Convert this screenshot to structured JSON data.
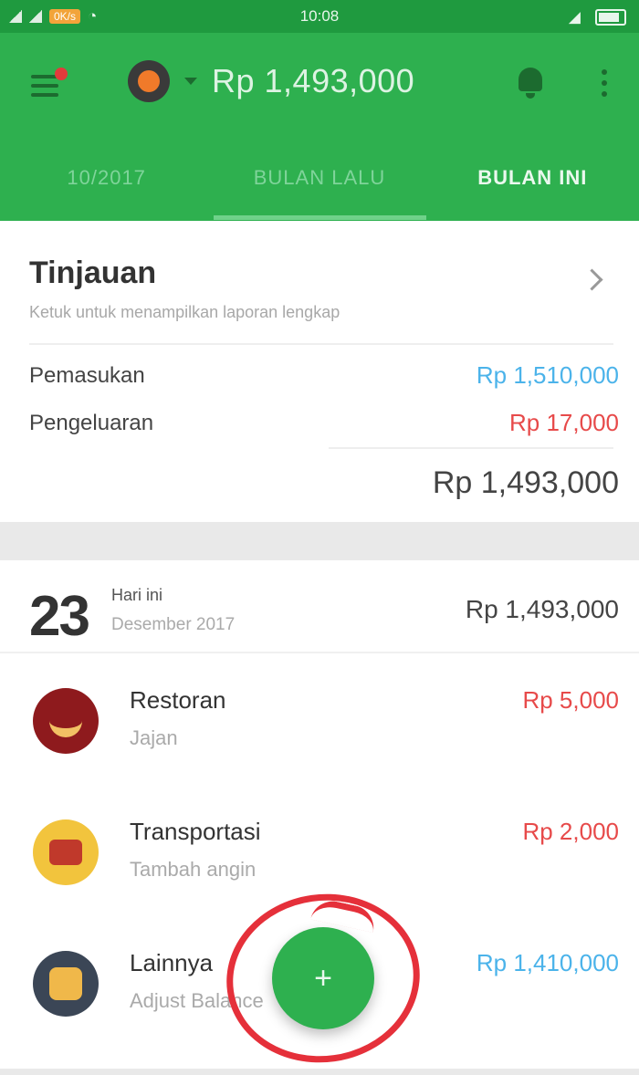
{
  "status_bar": {
    "time": "10:08",
    "speed_badge": "0K/s"
  },
  "appbar": {
    "balance": "Rp 1,493,000",
    "tabs": [
      {
        "label": "10/2017"
      },
      {
        "label": "BULAN LALU"
      },
      {
        "label": "BULAN INI"
      }
    ],
    "active_tab": "BULAN INI"
  },
  "overview": {
    "title": "Tinjauan",
    "subtitle": "Ketuk untuk menampilkan laporan lengkap",
    "income_label": "Pemasukan",
    "income_value": "Rp 1,510,000",
    "expense_label": "Pengeluaran",
    "expense_value": "Rp 17,000",
    "total": "Rp 1,493,000"
  },
  "day": {
    "number": "23",
    "name": "Hari ini",
    "date": "Desember 2017",
    "total": "Rp 1,493,000"
  },
  "transactions": [
    {
      "category": "Restoran",
      "note": "Jajan",
      "amount": "Rp 5,000",
      "type": "expense",
      "icon": "restaurant-icon",
      "color": "#8e1a1d"
    },
    {
      "category": "Transportasi",
      "note": "Tambah angin",
      "amount": "Rp 2,000",
      "type": "expense",
      "icon": "bus-icon",
      "color": "#f2c43d"
    },
    {
      "category": "Lainnya",
      "note": "Adjust Balance",
      "amount": "Rp 1,410,000",
      "type": "income",
      "icon": "stack-icon",
      "color": "#3b4656"
    }
  ],
  "fab": {
    "label": "+"
  },
  "colors": {
    "primary": "#2eb04f",
    "income": "#4bb3ea",
    "expense": "#e74a4a",
    "annotation": "#e5303a"
  }
}
